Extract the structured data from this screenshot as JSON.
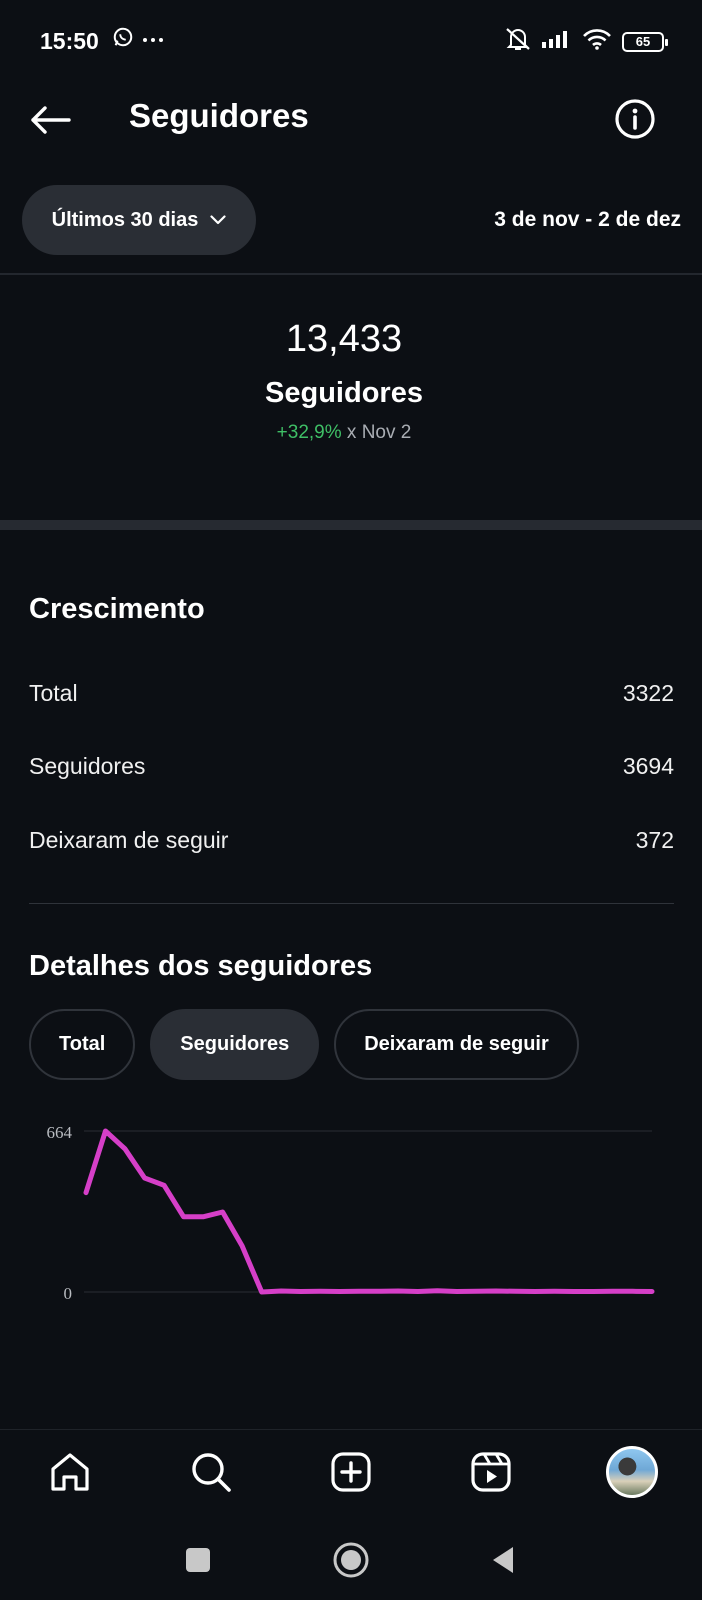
{
  "status_bar": {
    "time": "15:50",
    "battery": "65",
    "icons": [
      "whatsapp-icon",
      "more-icon",
      "mute-bell-icon",
      "signal-icon",
      "wifi-icon",
      "battery-icon"
    ]
  },
  "header": {
    "title": "Seguidores",
    "back_icon": "arrow-left-icon",
    "info_icon": "info-icon"
  },
  "filter": {
    "range_label": "Últimos 30 dias",
    "date_range": "3 de nov - 2 de dez"
  },
  "summary": {
    "count": "13,433",
    "label": "Seguidores",
    "change_pct": "+32,9%",
    "change_suffix": " x Nov 2"
  },
  "growth": {
    "title": "Crescimento",
    "rows": [
      {
        "label": "Total",
        "value": "3322"
      },
      {
        "label": "Seguidores",
        "value": "3694"
      },
      {
        "label": "Deixaram de seguir",
        "value": "372"
      }
    ]
  },
  "details": {
    "title": "Detalhes dos seguidores",
    "tabs": [
      {
        "label": "Total",
        "active": false
      },
      {
        "label": "Seguidores",
        "active": true
      },
      {
        "label": "Deixaram de seguir",
        "active": false
      }
    ]
  },
  "chart_data": {
    "type": "line",
    "y_ticks": [
      "664",
      "0"
    ],
    "ylim": [
      0,
      664
    ],
    "color": "#d63fc8",
    "series": [
      {
        "values": [
          410,
          664,
          590,
          470,
          440,
          310,
          310,
          330,
          190,
          0,
          4,
          2,
          3,
          2,
          3,
          3,
          4,
          2,
          5,
          2,
          3,
          4,
          3,
          2,
          3,
          2,
          2,
          3,
          3,
          2
        ]
      }
    ]
  },
  "bottom_nav": {
    "items": [
      "home-icon",
      "search-icon",
      "create-icon",
      "reels-icon",
      "profile-avatar"
    ]
  },
  "system_nav": {
    "items": [
      "recents-button",
      "home-button",
      "back-button"
    ]
  }
}
